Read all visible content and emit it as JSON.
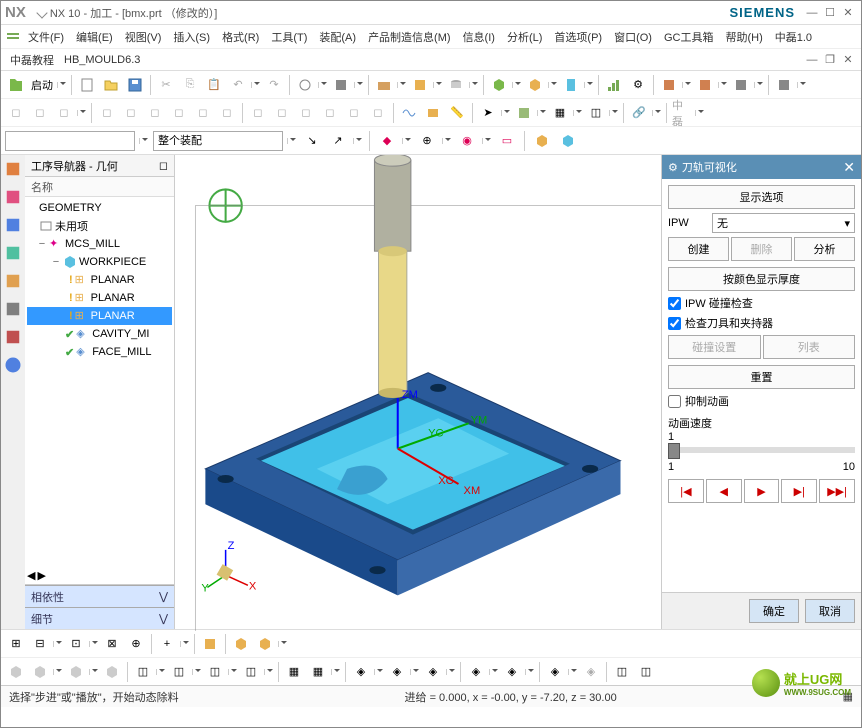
{
  "title": "NX 10 - 加工 - [bmx.prt （修改的）]",
  "brand": "SIEMENS",
  "menu": [
    "文件(F)",
    "编辑(E)",
    "视图(V)",
    "插入(S)",
    "格式(R)",
    "工具(T)",
    "装配(A)",
    "产品制造信息(M)",
    "信息(I)",
    "分析(L)",
    "首选项(P)",
    "窗口(O)",
    "GC工具箱",
    "帮助(H)",
    "中磊1.0"
  ],
  "menu2": [
    "中磊教程",
    "HB_MOULD6.3"
  ],
  "start_btn": "启动",
  "assembly_sel": "整个装配",
  "nav": {
    "header": "工序导航器 - 几何",
    "col": "名称",
    "root": "GEOMETRY",
    "unused": "未用项",
    "mcs": "MCS_MILL",
    "workpiece": "WORKPIECE",
    "planar": [
      "PLANAR",
      "PLANAR",
      "PLANAR"
    ],
    "cavity": "CAVITY_MI",
    "face": "FACE_MILL",
    "tabs": [
      "相依性",
      "细节"
    ]
  },
  "axes": {
    "zm": "ZM",
    "ym": "YM",
    "xc": "XC",
    "xm": "XM",
    "yc": "YC"
  },
  "panel": {
    "title": "刀轨可视化",
    "display_opts": "显示选项",
    "ipw_label": "IPW",
    "ipw_value": "无",
    "create": "创建",
    "delete": "删除",
    "analyze": "分析",
    "thickness": "按颜色显示厚度",
    "collision": "IPW 碰撞检查",
    "tool_holder": "检查刀具和夹持器",
    "coll_set": "碰撞设置",
    "list": "列表",
    "reset": "重置",
    "suppress": "抑制动画",
    "speed_label": "动画速度",
    "speed_val": "1",
    "speed_min": "1",
    "speed_max": "10",
    "ok": "确定",
    "cancel": "取消"
  },
  "status_left": "选择\"步进\"或\"播放\"，开始动态除料",
  "status_mid": "进给 = 0.000, x = -0.00, y = -7.20, z = 30.00",
  "watermark": {
    "line1": "就上UG网",
    "line2": "WWW.9SUG.COM"
  }
}
